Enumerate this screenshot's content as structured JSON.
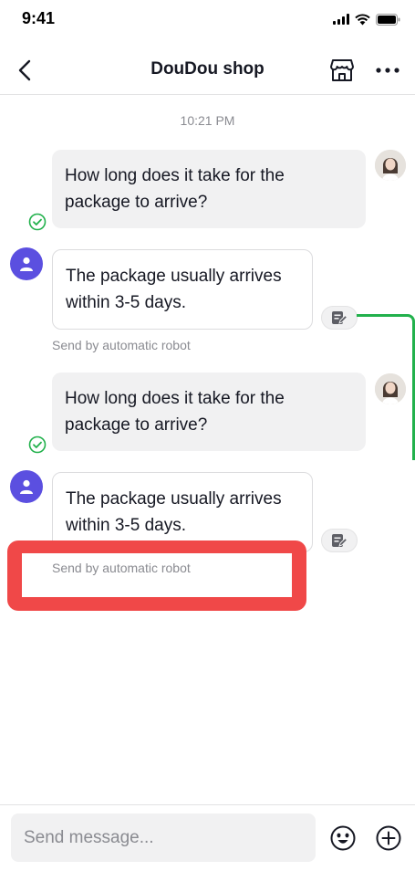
{
  "status_bar": {
    "time": "9:41"
  },
  "header": {
    "title": "DouDou shop"
  },
  "chat": {
    "timestamp": "10:21 PM",
    "messages": [
      {
        "sender": "user",
        "text": "How long does it take for the package to arrive?"
      },
      {
        "sender": "bot",
        "text": "The package usually arrives within 3-5 days.",
        "caption": "Send by automatic robot"
      },
      {
        "sender": "user",
        "text": "How long does it take for the package to arrive?"
      },
      {
        "sender": "bot",
        "text": "The package usually arrives within 3-5 days.",
        "caption": "Send by automatic robot"
      }
    ]
  },
  "composer": {
    "placeholder": "Send message..."
  },
  "colors": {
    "accent": "#5b4fe0",
    "highlight": "#f04848",
    "check": "#22b14c"
  }
}
